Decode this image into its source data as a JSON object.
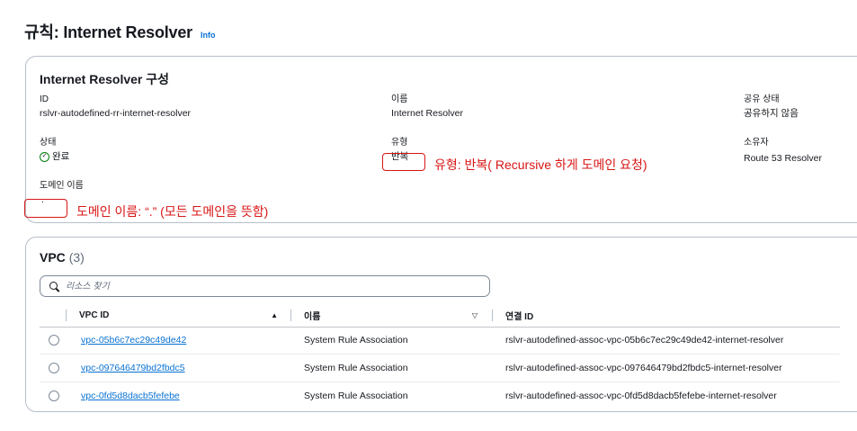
{
  "page": {
    "title": "규칙: Internet Resolver",
    "info": "Info"
  },
  "config": {
    "title": "Internet Resolver 구성",
    "id_label": "ID",
    "id_value": "rslvr-autodefined-rr-internet-resolver",
    "name_label": "이름",
    "name_value": "Internet Resolver",
    "share_label": "공유 상태",
    "share_value": "공유하지 않음",
    "status_label": "상태",
    "status_value": "완료",
    "type_label": "유형",
    "type_value": "반복",
    "owner_label": "소유자",
    "owner_value": "Route 53 Resolver",
    "domain_label": "도메인 이름",
    "domain_value": "."
  },
  "annotations": {
    "type_note": "유형: 반복( Recursive 하게 도메인 요청)",
    "domain_note": "도메인 이름: “.” (모든 도메인을 뜻함)"
  },
  "vpc": {
    "title": "VPC",
    "count": "(3)",
    "search_placeholder": "리소스 찾기",
    "columns": [
      "VPC ID",
      "이름",
      "연결 ID"
    ],
    "rows": [
      {
        "vpc_id": "vpc-05b6c7ec29c49de42",
        "name": "System Rule Association",
        "assoc_id": "rslvr-autodefined-assoc-vpc-05b6c7ec29c49de42-internet-resolver"
      },
      {
        "vpc_id": "vpc-097646479bd2fbdc5",
        "name": "System Rule Association",
        "assoc_id": "rslvr-autodefined-assoc-vpc-097646479bd2fbdc5-internet-resolver"
      },
      {
        "vpc_id": "vpc-0fd5d8dacb5fefebe",
        "name": "System Rule Association",
        "assoc_id": "rslvr-autodefined-assoc-vpc-0fd5d8dacb5fefebe-internet-resolver"
      }
    ]
  },
  "colors": {
    "link": "#0972d3",
    "success": "#037f0c",
    "annotation": "#d91515",
    "border": "#b6bec9"
  },
  "icons": [
    "check-circle-icon",
    "search-icon",
    "sort-ascending-icon",
    "sort-descending-icon",
    "radio-icon"
  ]
}
